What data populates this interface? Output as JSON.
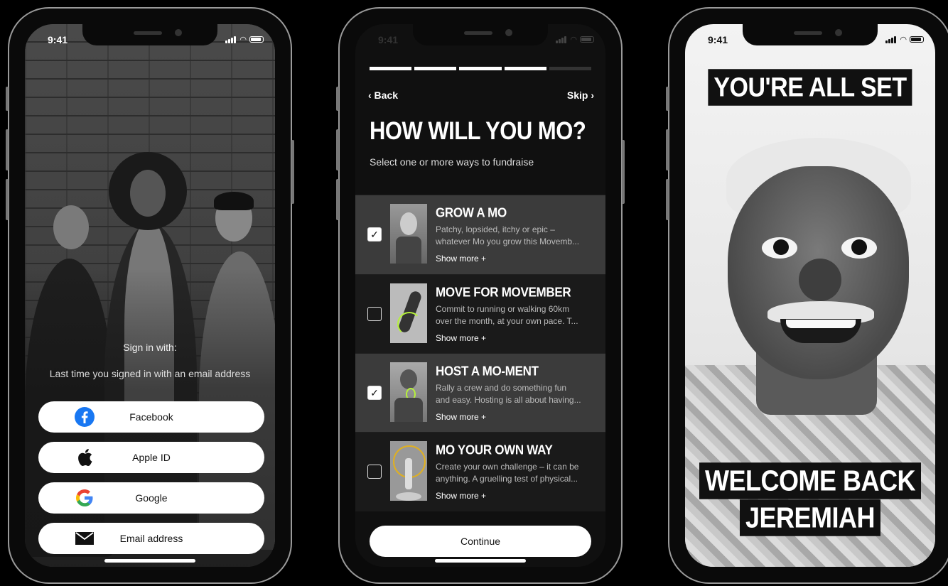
{
  "status": {
    "time": "9:41"
  },
  "signin_screen": {
    "heading": "Sign in with:",
    "last_time": "Last time you signed in with an email address",
    "buttons": [
      {
        "label": "Facebook",
        "icon": "facebook-icon"
      },
      {
        "label": "Apple ID",
        "icon": "apple-icon"
      },
      {
        "label": "Google",
        "icon": "google-icon"
      },
      {
        "label": "Email address",
        "icon": "mail-icon"
      }
    ]
  },
  "onboarding_screen": {
    "progress": {
      "total_steps": 5,
      "completed_steps": 4
    },
    "back_label": "‹ Back",
    "skip_label": "Skip ›",
    "title": "HOW WILL YOU MO?",
    "subtitle": "Select one or more ways to fundraise",
    "options": [
      {
        "title": "GROW A MO",
        "line1": "Patchy, lopsided, itchy or epic –",
        "line2": "whatever Mo you grow this Movemb...",
        "more": "Show more +",
        "checked": true
      },
      {
        "title": "MOVE FOR MOVEMBER",
        "line1": "Commit to running or walking 60km",
        "line2": "over the month, at your own pace. T...",
        "more": "Show more +",
        "checked": false
      },
      {
        "title": "HOST A MO-MENT",
        "line1": "Rally a crew and do something fun",
        "line2": "and easy. Hosting is all about having...",
        "more": "Show more +",
        "checked": true
      },
      {
        "title": "MO YOUR OWN WAY",
        "line1": "Create your own challenge – it can be",
        "line2": "anything. A gruelling test of physical...",
        "more": "Show more +",
        "checked": false
      }
    ],
    "continue_label": "Continue"
  },
  "welcome_screen": {
    "top_banner": "YOU'RE ALL SET",
    "welcome_line": "WELCOME BACK",
    "name_line": "JEREMIAH"
  },
  "colors": {
    "accent_green": "#b6f23a",
    "panel_selected": "#3b3b3b",
    "panel_unselected": "#1a1a1a",
    "facebook_blue": "#1877f2"
  }
}
